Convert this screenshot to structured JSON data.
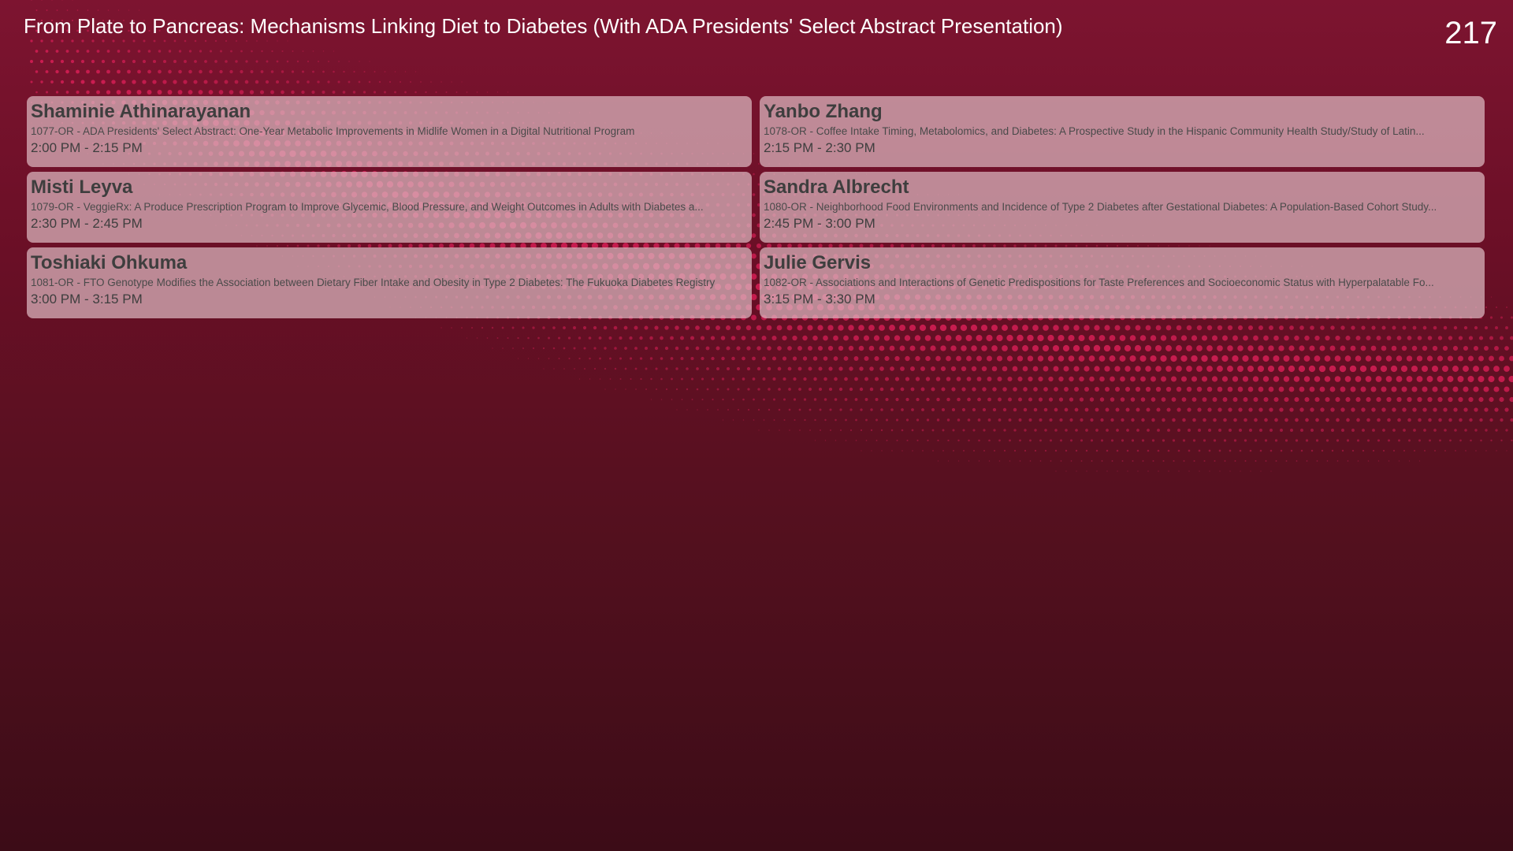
{
  "header": {
    "title": "From Plate to Pancreas: Mechanisms Linking Diet to Diabetes (With ADA Presidents' Select Abstract Presentation)",
    "room": "217"
  },
  "colors": {
    "background_top": "#7d1430",
    "background_bottom": "#3c0c17",
    "dot_accent": "#e0205a",
    "card_fill": "#dcb9c0",
    "card_text": "#3e3e3e"
  },
  "sessions": [
    {
      "speaker": "Shaminie Athinarayanan",
      "abstract": "1077-OR - ADA Presidents' Select Abstract: One-Year Metabolic Improvements in Midlife Women in a Digital Nutritional Program",
      "time": "2:00 PM - 2:15 PM"
    },
    {
      "speaker": "Yanbo Zhang",
      "abstract": " 1078-OR - Coffee Intake Timing, Metabolomics, and Diabetes: A Prospective Study in the Hispanic Community Health Study/Study of Latin...",
      "time": "2:15 PM - 2:30 PM"
    },
    {
      "speaker": "Misti Leyva",
      "abstract": " 1079-OR - VeggieRx: A Produce Prescription Program to Improve Glycemic, Blood Pressure, and Weight Outcomes in Adults with Diabetes a...",
      "time": "2:30 PM - 2:45 PM"
    },
    {
      "speaker": "Sandra Albrecht",
      "abstract": " 1080-OR - Neighborhood Food Environments and Incidence of Type 2 Diabetes after Gestational Diabetes: A Population-Based Cohort Study...",
      "time": "2:45 PM - 3:00 PM"
    },
    {
      "speaker": "Toshiaki Ohkuma",
      "abstract": "1081-OR - FTO Genotype Modifies the Association between Dietary Fiber Intake and Obesity in Type 2 Diabetes: The Fukuoka Diabetes Registry",
      "time": "3:00 PM - 3:15 PM"
    },
    {
      "speaker": "Julie Gervis",
      "abstract": " 1082-OR - Associations and Interactions of Genetic Predispositions for Taste Preferences and Socioeconomic Status with Hyperpalatable Fo...",
      "time": "3:15 PM - 3:30 PM"
    }
  ]
}
